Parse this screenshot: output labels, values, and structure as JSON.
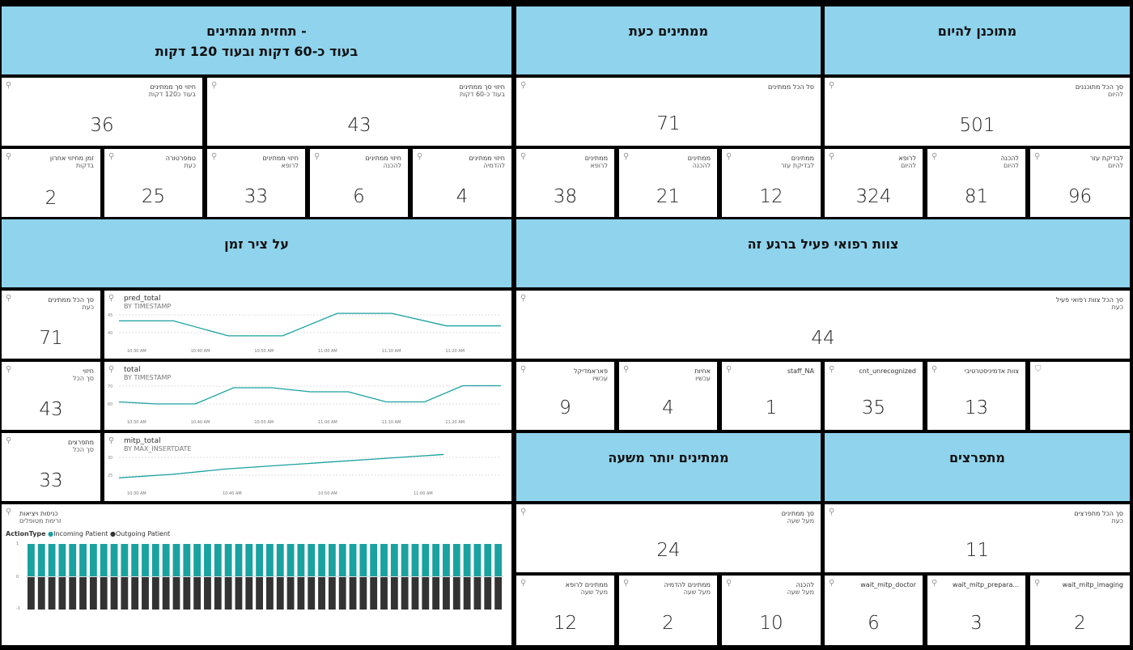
{
  "headers": {
    "forecast": {
      "line1": "תחזית ממתינים -",
      "line2": "בעוד כ-60 דקות ובעוד 120 דקות"
    },
    "waiting_now": "ממתינים כעת",
    "planned_today": "מתוכנן להיום",
    "timeline": "על ציר זמן",
    "active_staff": "צוות רפואי פעיל ברגע זה",
    "waiting_over_hour": "ממתינים יותר משעה",
    "breaking_out": "מתפרצים"
  },
  "tiles": {
    "pred120": {
      "title": "חיזוי סך ממתינים",
      "sub": "בעוד כ120 דקות",
      "value": "36"
    },
    "pred60": {
      "title": "חיזוי סך ממתינים",
      "sub": "בעוד כ-60 דקות",
      "value": "43"
    },
    "waiting_total": {
      "title": "סל הכל ממתינים",
      "sub": "",
      "value": "71"
    },
    "planned_total": {
      "title": "סך הכל מתוכננים",
      "sub": "להיום",
      "value": "501"
    },
    "last_pred_time": {
      "title": "זמן מחיזוי אחרון",
      "sub": "בדקות",
      "value": "2"
    },
    "temperature": {
      "title": "טמפרטורה",
      "sub": "כעת",
      "value": "25"
    },
    "pred_doctor": {
      "title": "חיזוי ממתינים",
      "sub": "לרופא",
      "value": "33"
    },
    "pred_prep": {
      "title": "חיזוי ממתינים",
      "sub": "להכנה",
      "value": "6"
    },
    "pred_imaging": {
      "title": "חיזוי ממתינים",
      "sub": "להדמיה",
      "value": "4"
    },
    "wait_doctor": {
      "title": "ממתינים",
      "sub": "לרופא",
      "value": "38"
    },
    "wait_prep": {
      "title": "ממתינים",
      "sub": "להכנה",
      "value": "21"
    },
    "wait_aux": {
      "title": "ממתינים",
      "sub": "לבדיקת עזר",
      "value": "12"
    },
    "plan_doctor": {
      "title": "לרופא",
      "sub": "להיום",
      "value": "324"
    },
    "plan_prep": {
      "title": "להכנה",
      "sub": "להיום",
      "value": "81"
    },
    "plan_aux": {
      "title": "לבדיקת עזר",
      "sub": "להיום",
      "value": "96"
    },
    "tl_total_wait": {
      "title": "סך הכל ממתינים",
      "sub": "כעת",
      "value": "71"
    },
    "tl_pred": {
      "title": "חיזוי",
      "sub": "סך הכל",
      "value": "43"
    },
    "tl_breaking": {
      "title": "מתפרצים",
      "sub": "סך הכל",
      "value": "33"
    },
    "staff_total": {
      "title": "סך הכל צוות רפואי פעיל",
      "sub": "כעת",
      "value": "44"
    },
    "staff_paramedic": {
      "title": "פאראמדיקל",
      "sub": "עכשיו",
      "value": "9"
    },
    "staff_nurses": {
      "title": "אחיות",
      "sub": "עכשיו",
      "value": "4"
    },
    "staff_na": {
      "title": "staff_NA",
      "sub": "",
      "value": "1"
    },
    "cnt_unrecognized": {
      "title": "cnt_unrecognized",
      "sub": "",
      "value": "35"
    },
    "staff_admin": {
      "title": "צוות אדמיניסטרטיבי",
      "sub": "",
      "value": "13"
    },
    "hour_total": {
      "title": "סך ממתינים",
      "sub": "מעל שעה",
      "value": "24"
    },
    "hour_doctor": {
      "title": "ממתינים לרופא",
      "sub": "מעל שעה",
      "value": "12"
    },
    "hour_imaging": {
      "title": "ממתינים להדמיה",
      "sub": "מעל שעה",
      "value": "2"
    },
    "hour_prep": {
      "title": "להכנה",
      "sub": "מעל שעה",
      "value": "10"
    },
    "brk_total": {
      "title": "סך הכל מתפרצים",
      "sub": "כעת",
      "value": "11"
    },
    "brk_doctor": {
      "title": "wait_mitp_doctor",
      "sub": "",
      "value": "6"
    },
    "brk_prep": {
      "title": "wait_mitp_prepara...",
      "sub": "",
      "value": "3"
    },
    "brk_imaging": {
      "title": "wait_mitp_imaging",
      "sub": "",
      "value": "2"
    }
  },
  "charts": {
    "pred_total": {
      "title": "pred_total",
      "sub": "BY TIMESTAMP"
    },
    "total": {
      "title": "total",
      "sub": "BY TIMESTAMP"
    },
    "mitp_total": {
      "title": "mitp_total",
      "sub": "BY MAX_INSERTDATE"
    },
    "inout": {
      "title": "כניסות ויציאות",
      "sub": "זרימת מטופלים",
      "legend_title": "ActionType",
      "legend_in": "Incoming Patient",
      "legend_out": "Outgoing Patient"
    }
  },
  "chart_data": [
    {
      "type": "line",
      "title": "pred_total",
      "x": [
        "10:30 AM",
        "10:40 AM",
        "10:50 AM",
        "11:00 AM",
        "11:10 AM",
        "11:20 AM"
      ],
      "values": [
        42,
        42,
        36,
        36,
        45,
        45,
        40,
        40
      ],
      "ylim": [
        34,
        47
      ],
      "ytick": "40",
      "ytick_top": "45",
      "color": "#19a2a0"
    },
    {
      "type": "line",
      "title": "total",
      "x": [
        "10:30 AM",
        "10:40 AM",
        "10:50 AM",
        "11:00 AM",
        "11:10 AM",
        "11:20 AM"
      ],
      "values": [
        63,
        62,
        62,
        70,
        70,
        68,
        68,
        63,
        63,
        71,
        71
      ],
      "ylim": [
        58,
        74
      ],
      "ytick": "60",
      "ytick_top": "70",
      "color": "#19a2a0"
    },
    {
      "type": "line",
      "title": "mitp_total",
      "x": [
        "10:30 AM",
        "10:40 AM",
        "10:50 AM",
        "11:00 AM"
      ],
      "values": [
        25,
        27,
        30,
        32,
        34,
        36,
        38
      ],
      "ylim": [
        22,
        40
      ],
      "ytick": "25",
      "ytick_top": "30",
      "color": "#19a2a0"
    },
    {
      "type": "bar",
      "title": "כניסות ויציאות",
      "series": [
        {
          "name": "Incoming Patient",
          "value": 1,
          "color": "#19a2a0"
        },
        {
          "name": "Outgoing Patient",
          "value": -1,
          "color": "#333333"
        }
      ],
      "bar_count": 46,
      "ylim": [
        -1,
        1
      ],
      "yticks": [
        "1",
        "0",
        "-1"
      ]
    }
  ],
  "colors": {
    "header": "#8fd3ec",
    "line": "#19a2a0",
    "bar_in": "#19a2a0",
    "bar_out": "#333333"
  }
}
